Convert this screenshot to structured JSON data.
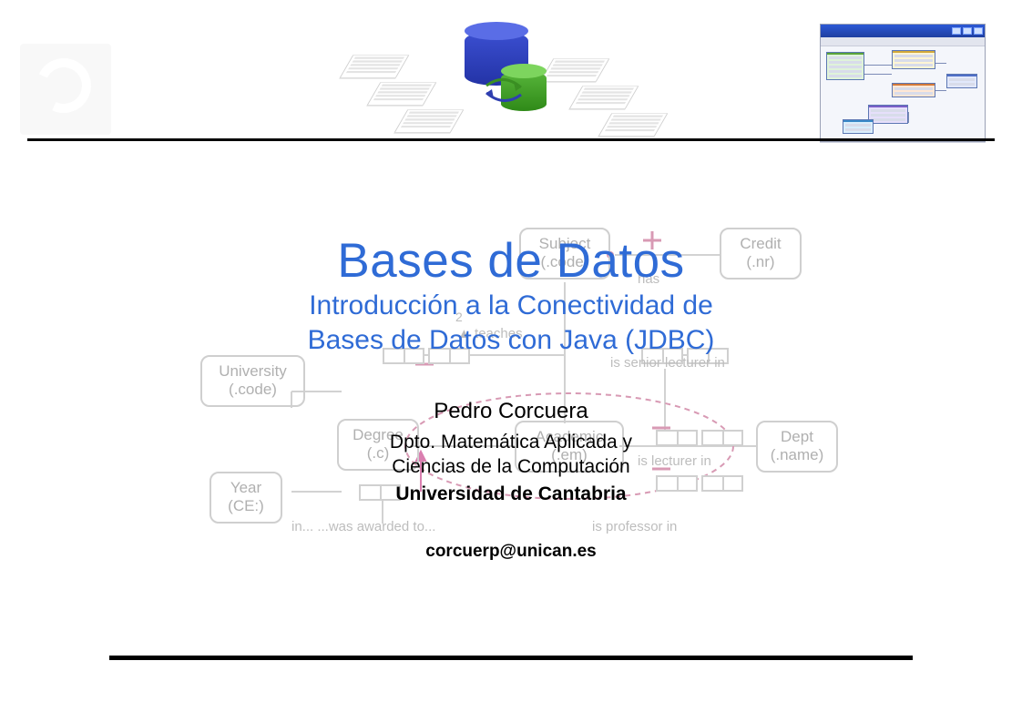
{
  "title": {
    "main": "Bases de Datos",
    "sub_line1": "Introducción a la Conectividad de",
    "sub_line2": "Bases de Datos con Java (JDBC)"
  },
  "author": {
    "name": "Pedro Corcuera",
    "dept_line1": "Dpto. Matemática Aplicada y",
    "dept_line2": "Ciencias de la Computación",
    "university": "Universidad de Cantabria",
    "email": "corcuerp@unican.es"
  },
  "er_diagram": {
    "boxes": {
      "subject": "Subject\n(.code)",
      "credit": "Credit\n(.nr)",
      "university": "University\n(.code)",
      "degree": "Degree\n(.c)",
      "academic": "Academic\n(.em)",
      "dept": "Dept\n(.name)",
      "year": "Year\n(CE:)"
    },
    "annotations": {
      "teaches": "teaches",
      "has": "has",
      "awarded": "in...  ...was awarded to...",
      "senior": "is senior lecturer in",
      "lecturer": "is lecturer in",
      "professor": "is professor in",
      "two": "2",
      "tri_up": "▲"
    }
  }
}
